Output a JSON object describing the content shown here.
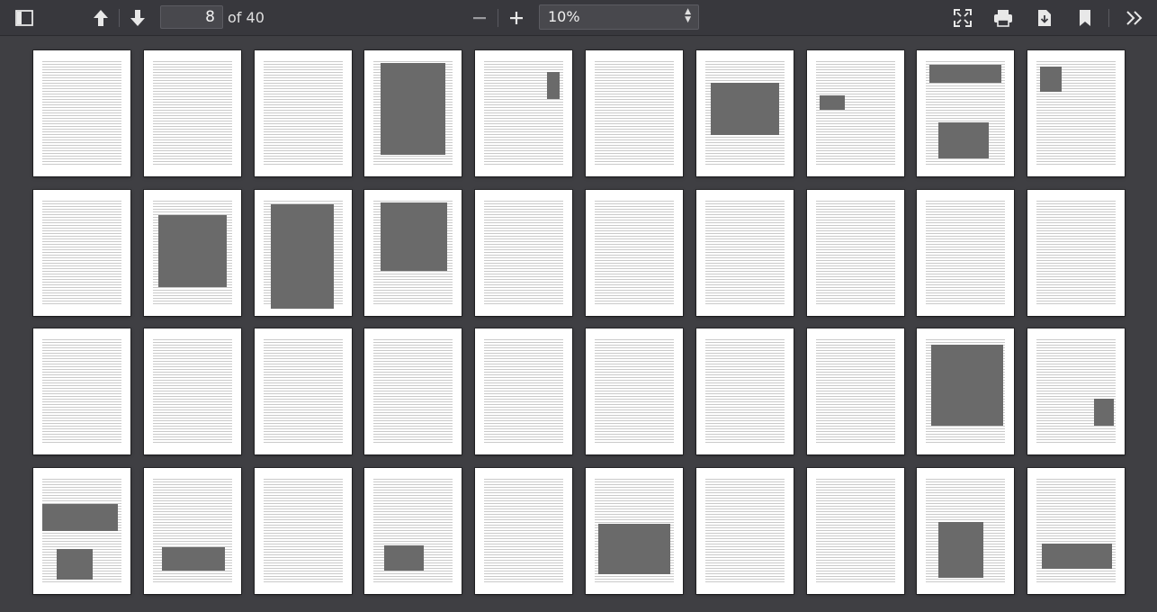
{
  "toolbar": {
    "page_number": "8",
    "page_of": "of 40",
    "zoom_value": "10%",
    "icons": {
      "sidebar": "sidebar-toggle-icon",
      "prev": "arrow-up-icon",
      "next": "arrow-down-icon",
      "zoom_out": "minus-icon",
      "zoom_in": "plus-icon",
      "fullscreen": "fullscreen-icon",
      "print": "printer-icon",
      "download": "download-icon",
      "bookmark": "bookmark-icon",
      "tools": "double-chevron-right-icon"
    }
  },
  "document": {
    "page_count": 40,
    "columns": 10
  },
  "colors": {
    "toolbar_bg": "#38383d",
    "viewer_bg": "#3f3f43",
    "page_bg": "#ffffff"
  }
}
